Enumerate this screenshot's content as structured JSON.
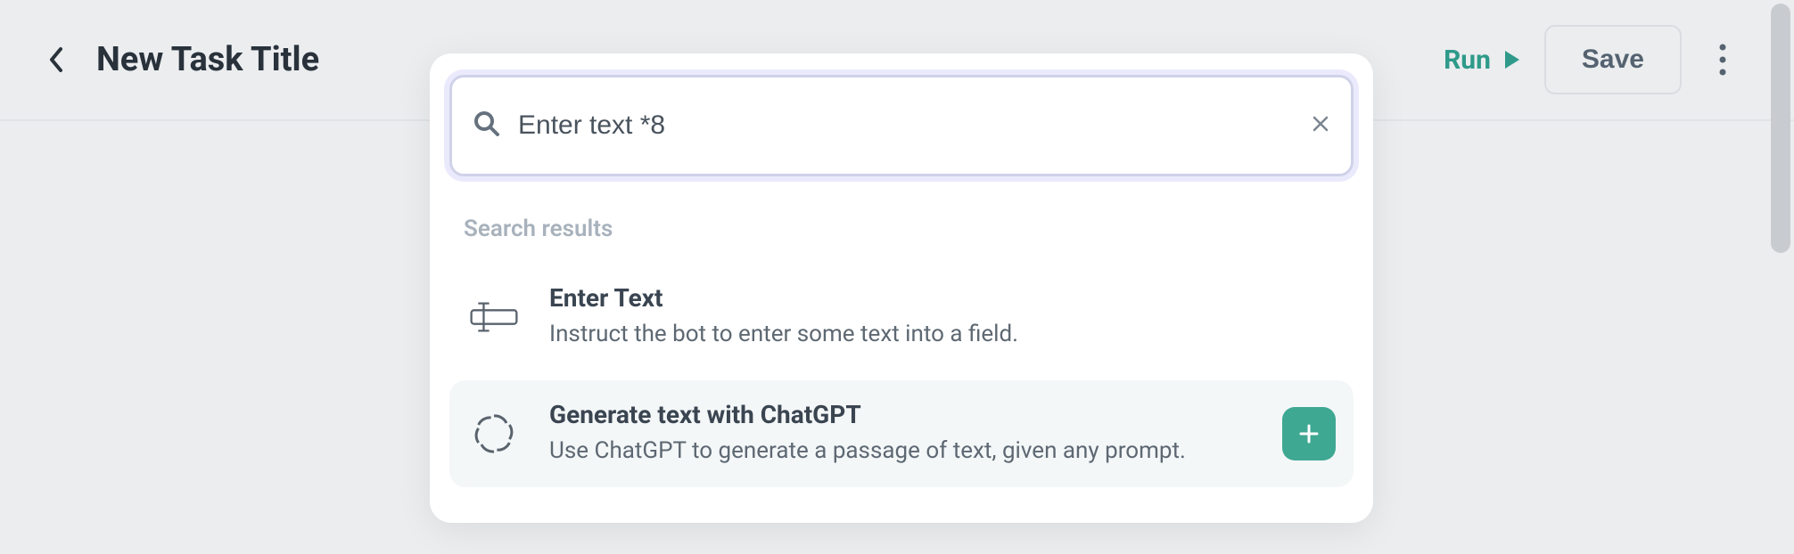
{
  "header": {
    "title": "New Task Title",
    "run_label": "Run",
    "save_label": "Save"
  },
  "search": {
    "value": "Enter text *8",
    "section_label": "Search results"
  },
  "results": [
    {
      "title": "Enter Text",
      "desc": "Instruct the bot to enter some text into a field."
    },
    {
      "title": "Generate text with ChatGPT",
      "desc": "Use ChatGPT to generate a passage of text, given any prompt."
    }
  ]
}
